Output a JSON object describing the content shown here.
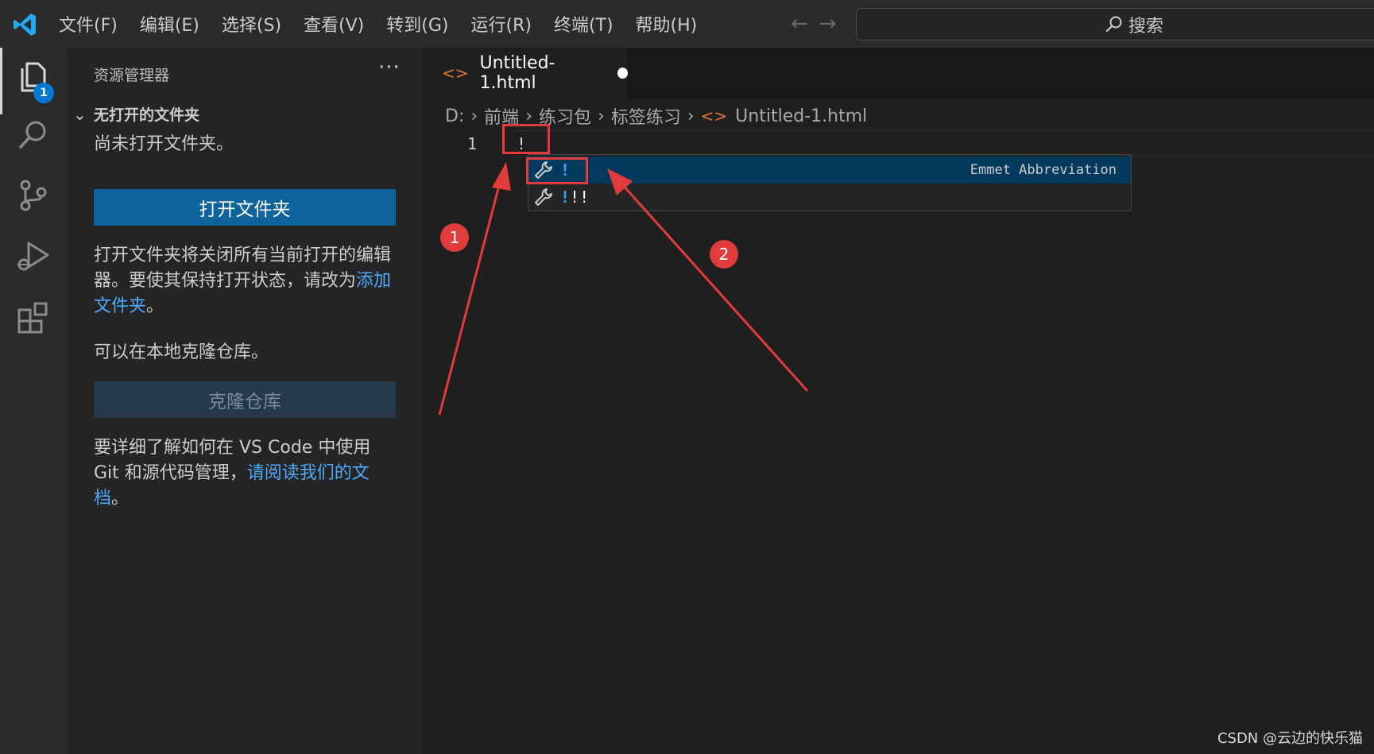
{
  "menu": [
    "文件(F)",
    "编辑(E)",
    "选择(S)",
    "查看(V)",
    "转到(G)",
    "运行(R)",
    "终端(T)",
    "帮助(H)"
  ],
  "search": {
    "label": "搜索"
  },
  "activity": {
    "badge": "1"
  },
  "sidebar": {
    "title": "资源管理器",
    "more": "···",
    "section": "无打开的文件夹",
    "no_folder_text": "尚未打开文件夹。",
    "open_folder_button": "打开文件夹",
    "info_text": "打开文件夹将关闭所有当前打开的编辑器。要使其保持打开状态，请改为",
    "add_folder_link": "添加文件夹",
    "period": "。",
    "clone_text": "可以在本地克隆仓库。",
    "clone_button": "克隆仓库",
    "learn_text": "要详细了解如何在 VS Code 中使用 Git 和源代码管理，",
    "docs_link": "请阅读我们的文档",
    "period2": "。"
  },
  "editor": {
    "tab_label": "Untitled-1.html",
    "breadcrumb": [
      "D:",
      "前端",
      "练习包",
      "标签练习",
      "Untitled-1.html"
    ],
    "line_number": "1",
    "code_line": "!"
  },
  "suggest": {
    "items": [
      {
        "label": "!",
        "detail": "Emmet Abbreviation"
      },
      {
        "label_hl": "!",
        "label_rest": "!!"
      }
    ]
  },
  "annotations": [
    "1",
    "2"
  ],
  "watermark": "CSDN @云边的快乐猫",
  "colors": {
    "accent": "#0078d4",
    "annotation": "#e23b3b",
    "button": "#0e639c"
  }
}
